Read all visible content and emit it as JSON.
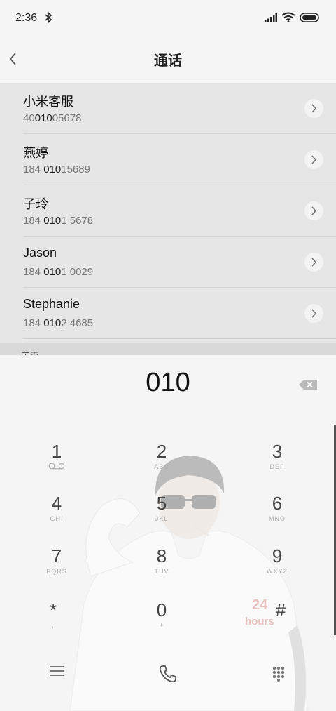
{
  "status_bar": {
    "time": "2:36",
    "icons": [
      "bluetooth-icon",
      "signal-icon",
      "wifi-icon",
      "battery-icon"
    ]
  },
  "header": {
    "title": "通话",
    "back_icon": "chevron-left-icon"
  },
  "contacts": [
    {
      "name": "小米客服",
      "number_parts": [
        "40",
        "010",
        "05678"
      ]
    },
    {
      "name": "燕婷",
      "number_parts": [
        "184 ",
        "010",
        "15689"
      ]
    },
    {
      "name": "子玲",
      "number_parts": [
        "184 ",
        "010",
        "1 5678"
      ]
    },
    {
      "name": "Jason",
      "number_parts": [
        "184 ",
        "010",
        "1 0029"
      ]
    },
    {
      "name": "Stephanie",
      "number_parts": [
        "184 ",
        "010",
        "2 4685"
      ]
    }
  ],
  "section_label": "黄页",
  "dialer": {
    "entered_number": "010",
    "keys": [
      {
        "digit": "1",
        "letters": ""
      },
      {
        "digit": "2",
        "letters": "ABC"
      },
      {
        "digit": "3",
        "letters": "DEF"
      },
      {
        "digit": "4",
        "letters": "GHI"
      },
      {
        "digit": "5",
        "letters": "JKL"
      },
      {
        "digit": "6",
        "letters": "MNO"
      },
      {
        "digit": "7",
        "letters": "PQRS"
      },
      {
        "digit": "8",
        "letters": "TUV"
      },
      {
        "digit": "9",
        "letters": "WXYZ"
      },
      {
        "digit": "*",
        "letters": ","
      },
      {
        "digit": "0",
        "letters": "+"
      },
      {
        "digit": "#",
        "letters": ""
      }
    ],
    "wallpaper_text": [
      "24",
      "hours"
    ]
  },
  "colors": {
    "background": "#f5f5f5",
    "list_background": "#e6e6e6",
    "accent_text": "#111111",
    "secondary_text": "#777777"
  }
}
